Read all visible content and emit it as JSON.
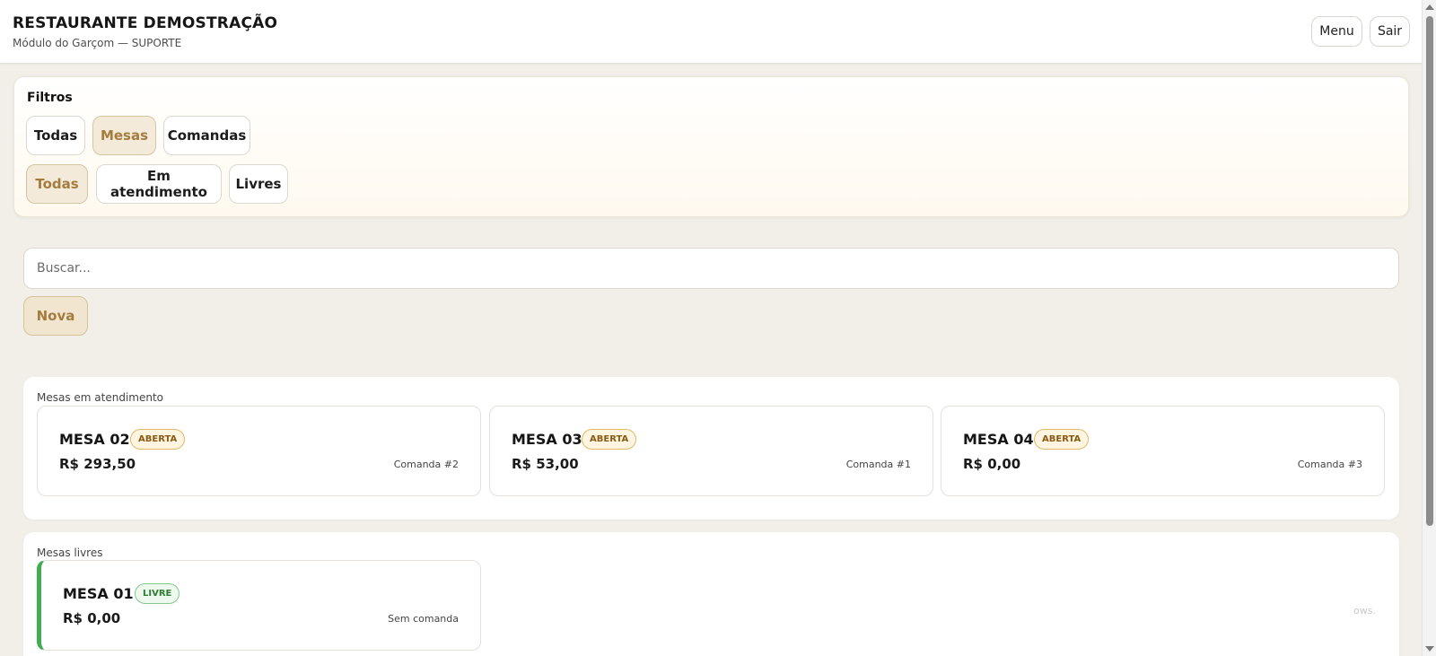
{
  "header": {
    "title": "RESTAURANTE DEMOSTRAÇÃO",
    "subtitle": "Módulo do Garçom — SUPORTE",
    "menu_label": "Menu",
    "exit_label": "Sair"
  },
  "filters": {
    "title": "Filtros",
    "type_chips": [
      {
        "label": "Todas",
        "active": false
      },
      {
        "label": "Mesas",
        "active": true
      },
      {
        "label": "Comandas",
        "active": false
      }
    ],
    "status_chips": [
      {
        "label": "Todas",
        "active": true
      },
      {
        "label": "Em atendimento",
        "active": false
      },
      {
        "label": "Livres",
        "active": false
      }
    ]
  },
  "search": {
    "placeholder": "Buscar...",
    "value": ""
  },
  "new_button_label": "Nova",
  "sections": {
    "busy": {
      "title": "Mesas em atendimento",
      "tables": [
        {
          "name": "MESA 02",
          "status": "ABERTA",
          "total": "R$ 293,50",
          "ref": "Comanda #2"
        },
        {
          "name": "MESA 03",
          "status": "ABERTA",
          "total": "R$ 53,00",
          "ref": "Comanda #1"
        },
        {
          "name": "MESA 04",
          "status": "ABERTA",
          "total": "R$ 0,00",
          "ref": "Comanda #3"
        }
      ]
    },
    "free": {
      "title": "Mesas livres",
      "tables": [
        {
          "name": "MESA 01",
          "status": "LIVRE",
          "total": "R$ 0,00",
          "ref": "Sem comanda"
        }
      ]
    }
  },
  "faint_text": "ows.",
  "colors": {
    "accent": "#a47c3e",
    "accent_bg": "#f3ead9",
    "open_badge": "#e0b868",
    "free_badge": "#3fae4f",
    "background": "#f2efe9"
  }
}
